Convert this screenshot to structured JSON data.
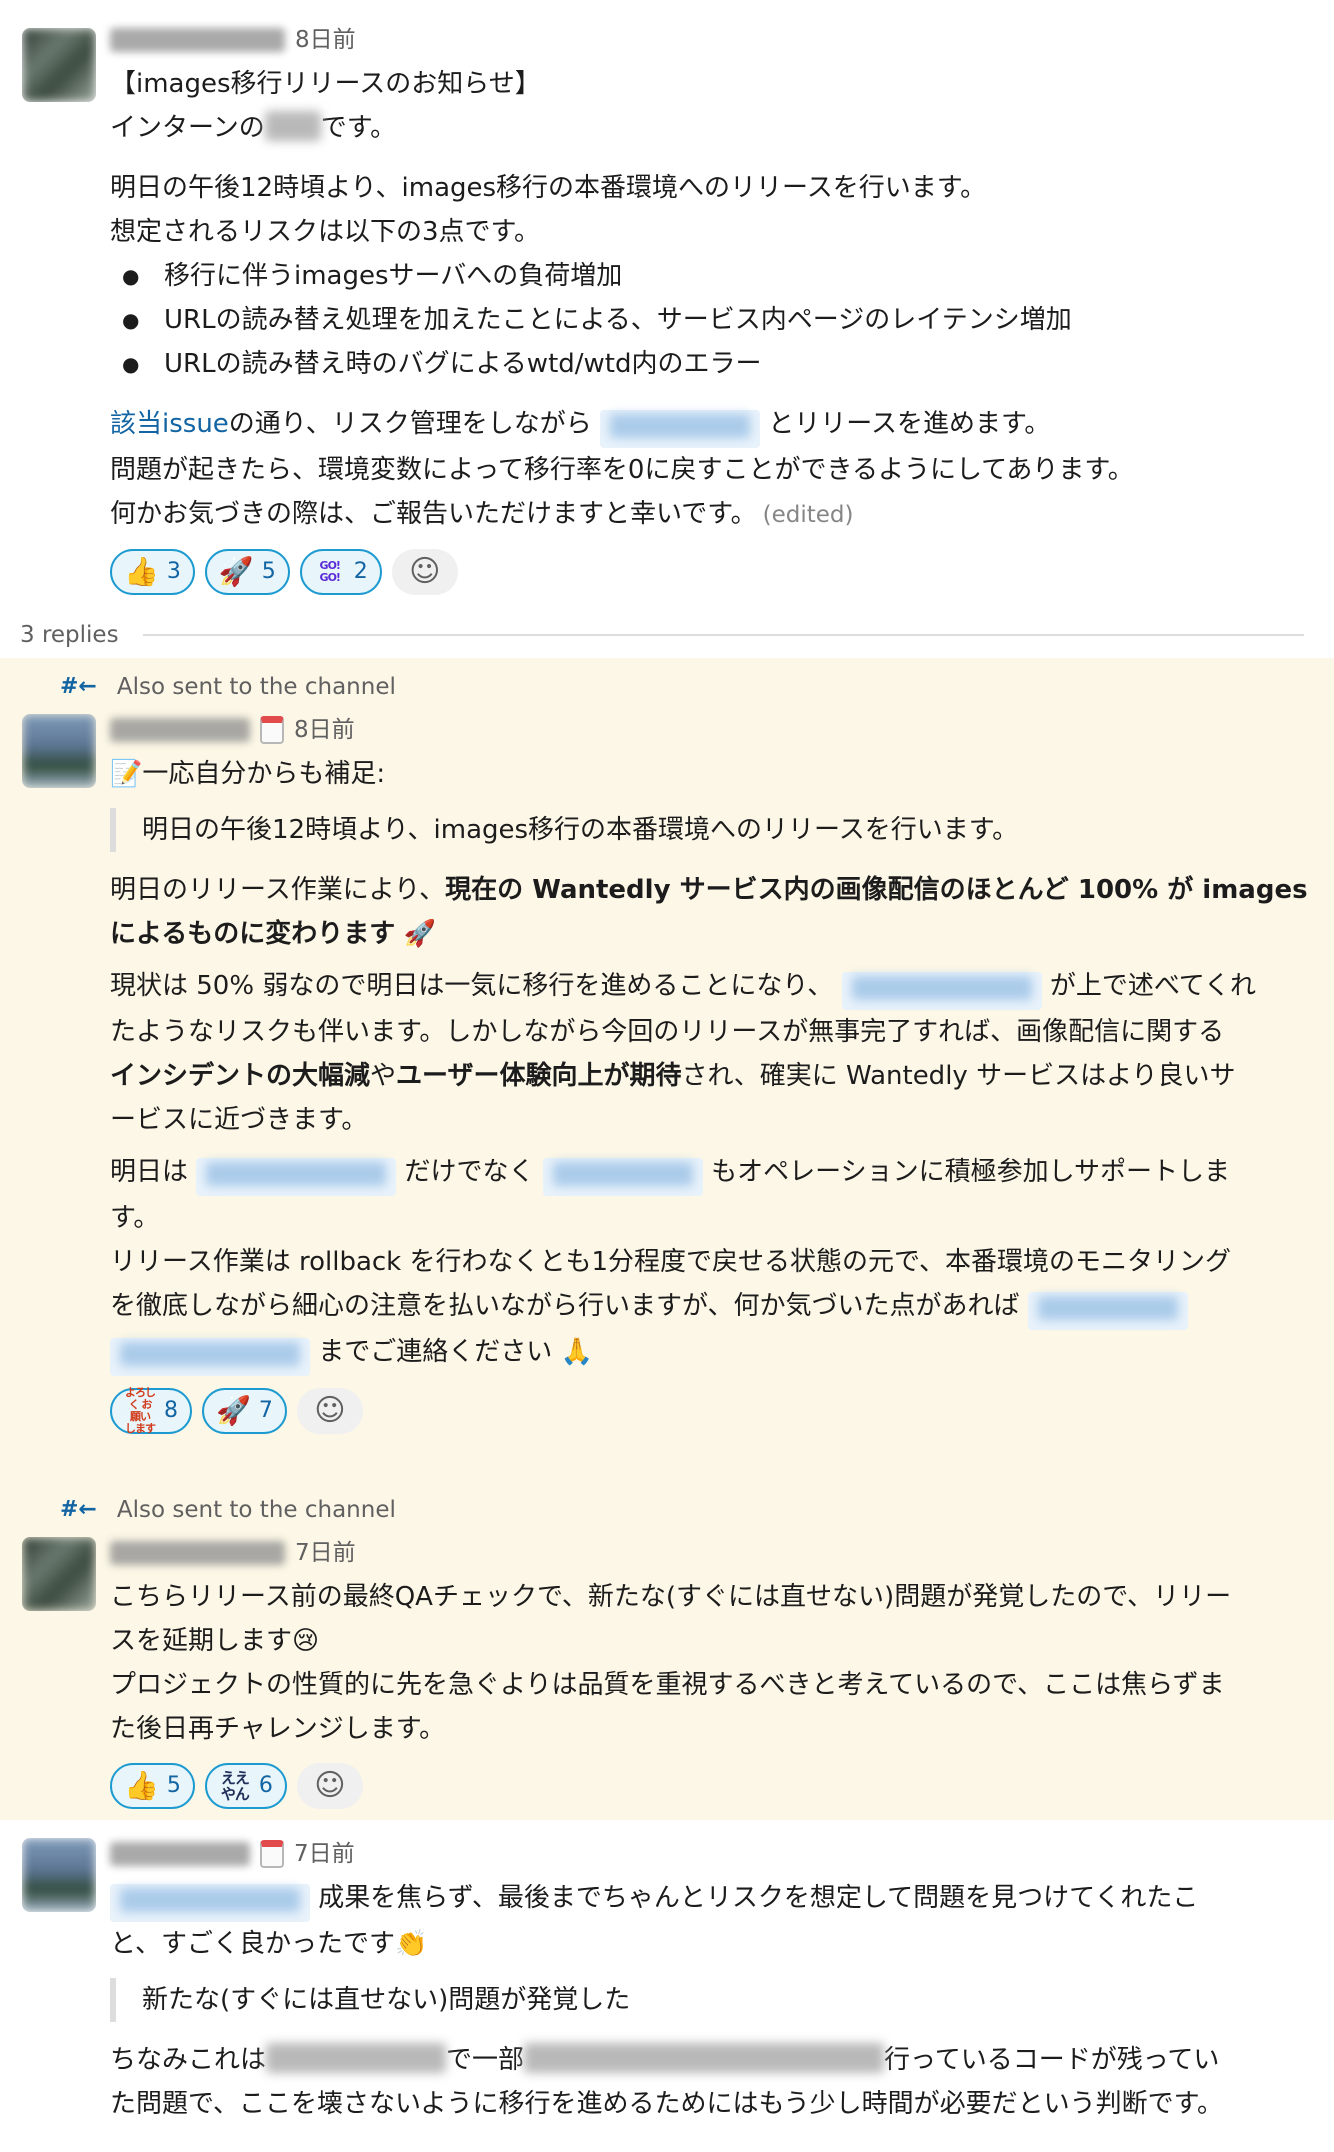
{
  "colors": {
    "link": "#1264a3",
    "reaction_border": "#1d9bd1",
    "highlight_bg": "#fcf7e6",
    "mention_bg": "#e8f2fb"
  },
  "root": {
    "time": "8日前",
    "title": "【images移行リリースのお知らせ】",
    "intro_a": "インターンの",
    "intro_b": "です。",
    "p1": "明日の午後12時頃より、images移行の本番環境へのリリースを行います。",
    "p2": "想定されるリスクは以下の3点です。",
    "risks": [
      "移行に伴うimagesサーバへの負荷増加",
      "URLの読み替え処理を加えたことによる、サービス内ページのレイテンシ増加",
      "URLの読み替え時のバグによるwtd/wtd内のエラー"
    ],
    "issue_link": "該当issue",
    "p3a": "の通り、リスク管理をしながら",
    "p3b": "とリリースを進めます。",
    "p4": "問題が起きたら、環境変数によって移行率を0に戻すことができるようにしてあります。",
    "p5": "何かお気づきの際は、ご報告いただけますと幸いです。",
    "edited": "(edited)",
    "reactions": [
      {
        "icon": "thumbs-up",
        "glyph": "👍",
        "count": "3"
      },
      {
        "icon": "rocket",
        "glyph": "🚀",
        "count": "5"
      },
      {
        "icon": "gogo",
        "glyph": "GO! GO!",
        "count": "2"
      }
    ]
  },
  "replies_label": "3 replies",
  "also_sent": "Also sent to the channel",
  "reply1": {
    "time": "8日前",
    "lead_emoji": "📝",
    "lead": "一応自分からも補足:",
    "quote": "明日の午後12時頃より、images移行の本番環境へのリリースを行います。",
    "b1_a": "明日のリリース作業により、",
    "b1_bold": "現在の Wantedly サービス内の画像配信のほとんど 100% が images",
    "b2_bold": "によるものに変わります",
    "b2_emoji": "🚀",
    "c1_a": "現状は 50% 弱なので明日は一気に移行を進めることになり、",
    "c1_b": "が上で述べてくれ",
    "c2": "たようなリスクも伴います。しかしながら今回のリリースが無事完了すれば、画像配信に関する",
    "c3_bold1": "インシデントの大幅減",
    "c3_mid": "や",
    "c3_bold2": "ユーザー体験向上が期待",
    "c3_end": "され、確実に Wantedly サービスはより良いサ",
    "c4": "ービスに近づきます。",
    "d1_a": "明日は",
    "d1_b": "だけでなく",
    "d1_c": "もオペレーションに積極参加しサポートしま",
    "d2": "す。",
    "e1": "リリース作業は rollback を行わなくとも1分程度で戻せる状態の元で、本番環境のモニタリング",
    "e2": "を徹底しながら細心の注意を払いながら行いますが、何か気づいた点があれば",
    "e3": "までご連絡ください",
    "e3_emoji": "🙏",
    "reactions": [
      {
        "icon": "yoroshiku-onegaishimasu",
        "glyph": "よろしく お願い します",
        "count": "8"
      },
      {
        "icon": "rocket",
        "glyph": "🚀",
        "count": "7"
      }
    ]
  },
  "reply2": {
    "time": "7日前",
    "l1": "こちらリリース前の最終QAチェックで、新たな(すぐには直せない)問題が発覚したので、リリー",
    "l2": "スを延期します",
    "l2_emoji": "😢",
    "l3": "プロジェクトの性質的に先を急ぐよりは品質を重視するべきと考えているので、ここは焦らずま",
    "l4": "た後日再チャレンジします。",
    "reactions": [
      {
        "icon": "thumbs-up",
        "glyph": "👍",
        "count": "5"
      },
      {
        "icon": "eei",
        "glyph": "ええ やん",
        "count": "6"
      }
    ]
  },
  "reply3": {
    "time": "7日前",
    "l1": "成果を焦らず、最後までちゃんとリスクを想定して問題を見つけてくれたこ",
    "l2": "と、すごく良かったです",
    "l2_emoji": "👏",
    "quote": "新たな(すぐには直せない)問題が発覚した",
    "l3_a": "ちなみこれは",
    "l3_b": "で一部",
    "l3_c": "行っているコードが残ってい",
    "l4": "た問題で、ここを壊さないように移行を進めるためにはもう少し時間が必要だという判断です。"
  }
}
